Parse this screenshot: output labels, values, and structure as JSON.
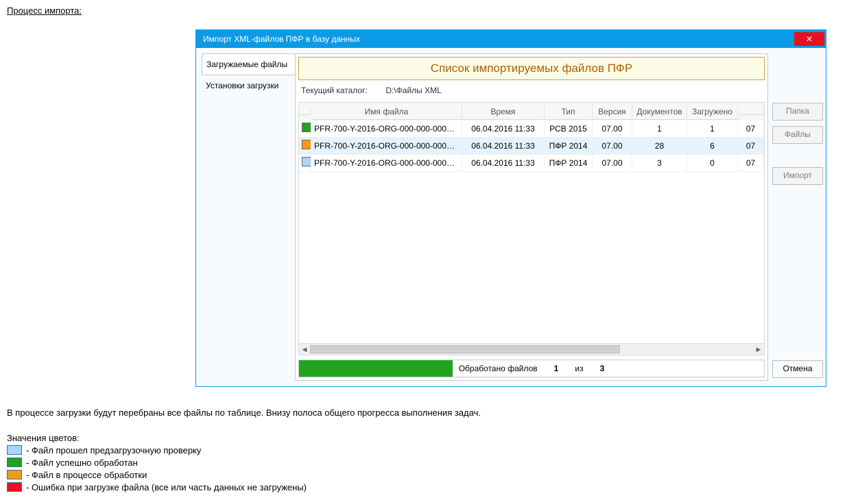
{
  "section_title": "Процесс импорта:",
  "window": {
    "title": "Импорт XML-файлов ПФР в базу данных",
    "close_glyph": "✕"
  },
  "tabs": [
    {
      "label": "Загружаемые файлы",
      "active": true
    },
    {
      "label": "Установки загрузки",
      "active": false
    }
  ],
  "list_title": "Список импортируемых файлов ПФР",
  "catalog": {
    "label": "Текущий каталог:",
    "value": "D:\\Файлы XML"
  },
  "grid": {
    "headers": [
      "",
      "Имя файла",
      "Время",
      "Тип",
      "Версия",
      "Документов",
      "Загружено",
      ""
    ],
    "rows": [
      {
        "color": "#21a321",
        "file": "PFR-700-Y-2016-ORG-000-000-000000-...",
        "time": "06.04.2016 11:33",
        "type": "РСВ 2015",
        "ver": "07.00",
        "docs": "1",
        "loaded": "1",
        "tail": "07",
        "selected": false
      },
      {
        "color": "#f29a18",
        "file": "PFR-700-Y-2016-ORG-000-000-000000-...",
        "time": "06.04.2016 11:33",
        "type": "ПФР 2014",
        "ver": "07.00",
        "docs": "28",
        "loaded": "6",
        "tail": "07",
        "selected": true
      },
      {
        "color": "#a9d6f5",
        "file": "PFR-700-Y-2016-ORG-000-000-000000-...",
        "time": "06.04.2016 11:33",
        "type": "ПФР 2014",
        "ver": "07.00",
        "docs": "3",
        "loaded": "0",
        "tail": "07",
        "selected": false
      }
    ]
  },
  "progress": {
    "label": "Обработано файлов",
    "done": "1",
    "of_label": "из",
    "total": "3",
    "percent": 33
  },
  "buttons": {
    "folder": "Папка",
    "files": "Файлы",
    "import": "Импорт",
    "cancel": "Отмена"
  },
  "description": "В процессе загрузки будут перебраны все файлы по таблице. Внизу полоса общего прогресса выполнения задач.",
  "legend_title": "Значения  цветов:",
  "legend": [
    {
      "color": "#a9d6f5",
      "text": "- Файл прошел предзагрузочную проверку"
    },
    {
      "color": "#21a321",
      "text": "- Файл успешно обработан"
    },
    {
      "color": "#f29a18",
      "text": "- Файл в процессе обработки"
    },
    {
      "color": "#e81123",
      "text": "- Ошибка при загрузке файла (все или часть данных не загружены)"
    }
  ]
}
